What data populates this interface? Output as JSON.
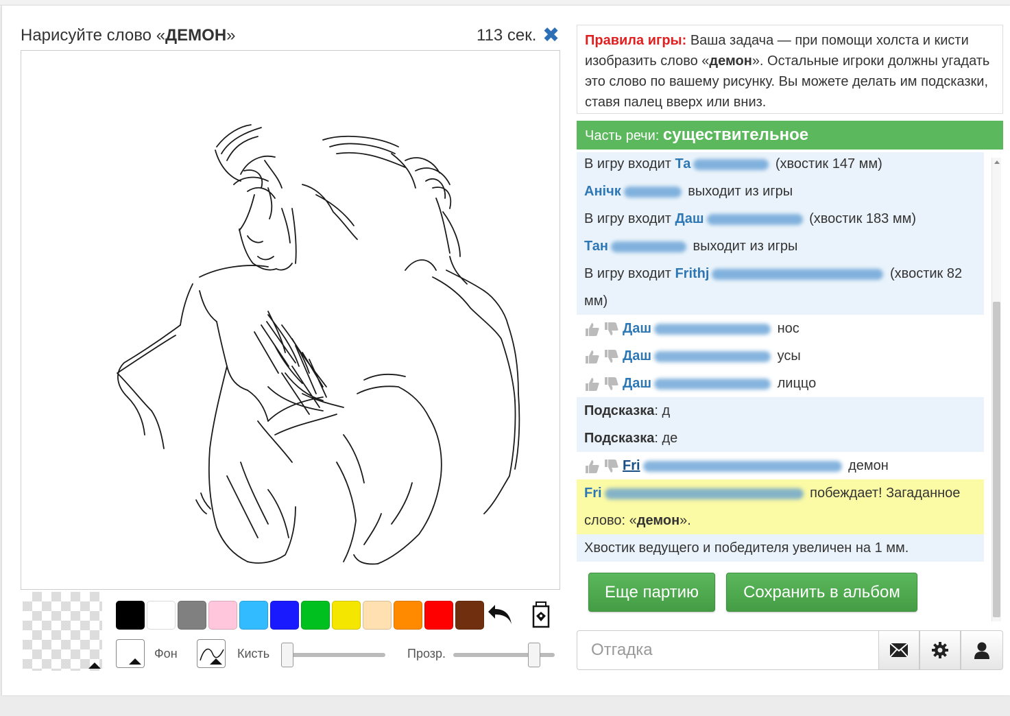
{
  "game": {
    "title_prefix": "Нарисуйте слово «",
    "word_upper": "ДЕМОН",
    "title_suffix": "»",
    "timer": "113 сек."
  },
  "rules": {
    "label": "Правила игры:",
    "text_1": " Ваша задача — при помощи холста и кисти изобразить слово «",
    "word": "демон",
    "text_2": "». Остальные игроки должны угадать это слово по вашему рисунку. Вы можете делать им подсказки, ставя палец вверх или вниз."
  },
  "part_of_speech": {
    "label": "Часть речи:",
    "value": "существительное"
  },
  "toolbar": {
    "colors": [
      "#000000",
      "#ffffff",
      "#808080",
      "#ffc6dc",
      "#33bbff",
      "#1a1aff",
      "#00c020",
      "#f5e600",
      "#ffe0b0",
      "#ff8a00",
      "#ff0000",
      "#70300f"
    ],
    "background_label": "Фон",
    "brush_label": "Кисть",
    "opacity_label": "Прозр.",
    "brush_size": 0.0,
    "opacity": 0.8
  },
  "chat": {
    "join_1": {
      "prefix": "В игру входит ",
      "nick": "Та",
      "suffix": " (хвостик 147 мм)"
    },
    "leave_1": {
      "nick": "Анічк",
      "suffix": " выходит из игры"
    },
    "join_2": {
      "prefix": "В игру входит ",
      "nick": "Даш",
      "suffix": " (хвостик 183 мм)"
    },
    "leave_2": {
      "nick": "Тан",
      "suffix": " выходит из игры"
    },
    "join_3": {
      "prefix": "В игру входит ",
      "nick": "Frithj",
      "suffix": " (хвостик 82 мм)"
    },
    "guess_1": {
      "nick": "Даш",
      "text": "нос"
    },
    "guess_2": {
      "nick": "Даш",
      "text": "усы"
    },
    "guess_3": {
      "nick": "Даш",
      "text": "лиццо"
    },
    "hint_1": {
      "label": "Подсказка",
      "text": ": д"
    },
    "hint_2": {
      "label": "Подсказка",
      "text": ": де"
    },
    "guess_4": {
      "nick": "Fri",
      "text": "демон"
    },
    "win": {
      "nick": "Fri",
      "text_1": " побеждает! Загаданное слово: «",
      "word": "демон",
      "text_2": "»."
    },
    "tail_info": "Хвостик ведущего и победителя увеличен на 1 мм."
  },
  "buttons": {
    "play_again": "Еще партию",
    "save_album": "Сохранить в альбом"
  },
  "guess": {
    "placeholder": "Отгадка"
  }
}
